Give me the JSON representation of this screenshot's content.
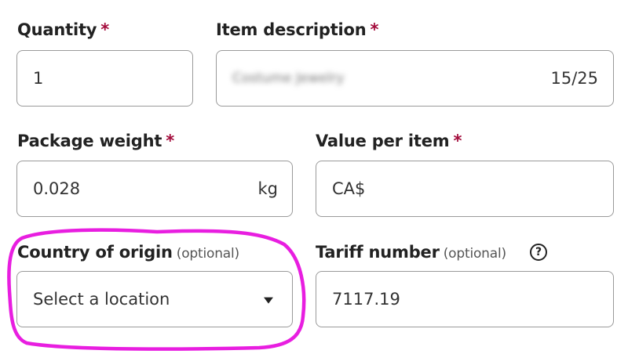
{
  "form": {
    "quantity": {
      "label": "Quantity",
      "required_mark": "*",
      "value": "1"
    },
    "item_description": {
      "label": "Item description",
      "required_mark": "*",
      "value": "Costume Jewelry",
      "value_obscured": true,
      "char_count": "15/25"
    },
    "package_weight": {
      "label": "Package weight",
      "required_mark": "*",
      "value": "0.028",
      "unit": "kg"
    },
    "value_per_item": {
      "label": "Value per item",
      "required_mark": "*",
      "prefix": "CA$",
      "value": ""
    },
    "country_of_origin": {
      "label": "Country of origin",
      "optional_text": "(optional)",
      "selected": "Select a location"
    },
    "tariff_number": {
      "label": "Tariff number",
      "optional_text": "(optional)",
      "value": "7117.19",
      "help_icon": "?"
    }
  },
  "icons": {
    "dropdown": "chevron-down-icon",
    "help": "help-circle-icon"
  },
  "colors": {
    "required": "#a30b3b",
    "border": "#9a9a9a",
    "annotation": "#e81ee0"
  }
}
